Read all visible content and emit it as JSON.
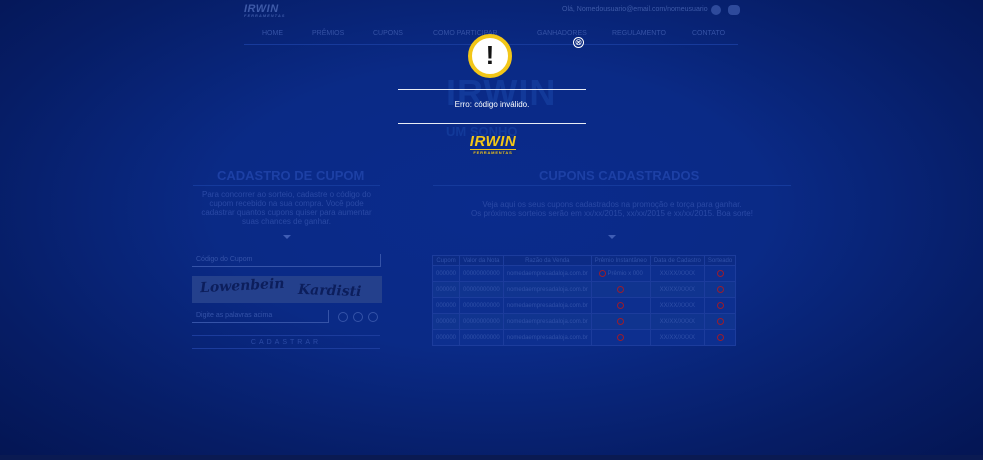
{
  "header": {
    "logo_text": "IRWIN",
    "logo_sub": "FERRAMENTAS",
    "welcome": "Olá, Nomedousuario@email.com/nomeusuario"
  },
  "nav": {
    "items": [
      "HOME",
      "PRÊMIOS",
      "CUPONS",
      "COMO PARTICIPAR",
      "GANHADORES",
      "REGULAMENTO",
      "CONTATO"
    ]
  },
  "hero": {
    "big": "IRWIN",
    "sub": "UM SONHO"
  },
  "cadastro": {
    "title": "CADASTRO DE CUPOM",
    "text": "Para concorrer ao sorteio, cadastre o código do cupom recebido na sua compra. Você pode cadastrar quantos cupons quiser para aumentar suas chances de ganhar.",
    "code_placeholder": "Código do Cupom",
    "captcha_word1": "Lowenbein",
    "captcha_word2": "Kardisti",
    "captcha_placeholder": "Digite as palavras acima",
    "submit_label": "CADASTRAR"
  },
  "cupons": {
    "title": "CUPONS CADASTRADOS",
    "text_line1": "Veja aqui os seus cupons cadastrados na promoção e torça para ganhar.",
    "text_line2": "Os próximos sorteios serão em xx/xx/2015, xx/xx/2015 e xx/xx/2015. Boa sorte!",
    "headers": [
      "Cupom",
      "Valor da Nota",
      "Razão da Venda",
      "Prêmio Instantâneo",
      "Data de Cadastro",
      "Sorteado"
    ],
    "rows": [
      {
        "cupom": "000000",
        "valor": "00000000000",
        "razao": "nomedaempresadaloja.com.br",
        "premio": "Prêmio x 000",
        "data": "XX/XX/XXXX"
      },
      {
        "cupom": "000000",
        "valor": "00000000000",
        "razao": "nomedaempresadaloja.com.br",
        "premio": "",
        "data": "XX/XX/XXXX"
      },
      {
        "cupom": "000000",
        "valor": "00000000000",
        "razao": "nomedaempresadaloja.com.br",
        "premio": "",
        "data": "XX/XX/XXXX"
      },
      {
        "cupom": "000000",
        "valor": "00000000000",
        "razao": "nomedaempresadaloja.com.br",
        "premio": "",
        "data": "XX/XX/XXXX"
      },
      {
        "cupom": "000000",
        "valor": "00000000000",
        "razao": "nomedaempresadaloja.com.br",
        "premio": "",
        "data": "XX/XX/XXXX"
      }
    ]
  },
  "modal": {
    "icon": "exclamation-icon",
    "message": "Erro: código inválido.",
    "close_glyph": "⊗",
    "brand_text": "IRWIN",
    "brand_sub": "FERRAMENTAS"
  },
  "colors": {
    "background": "#0a2a86",
    "accent_yellow": "#f2c618",
    "text_white": "#ffffff"
  }
}
